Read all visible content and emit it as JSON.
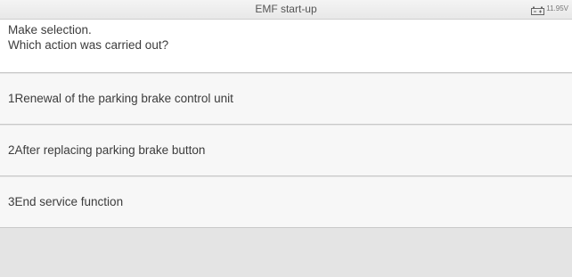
{
  "title_bar": {
    "title": "EMF start-up",
    "battery_icon": "battery-icon",
    "voltage": "11.95V"
  },
  "prompt": {
    "line1": "Make selection.",
    "line2": "Which action was carried out?"
  },
  "options": [
    {
      "label": "1Renewal of the parking brake control unit"
    },
    {
      "label": "2After replacing parking brake button"
    },
    {
      "label": "3End service function"
    }
  ],
  "colors": {
    "background": "#e6e6e6",
    "panel": "#ffffff",
    "option_bg": "#f7f7f7",
    "divider": "#c9c9c9",
    "text": "#3c3c3c"
  }
}
